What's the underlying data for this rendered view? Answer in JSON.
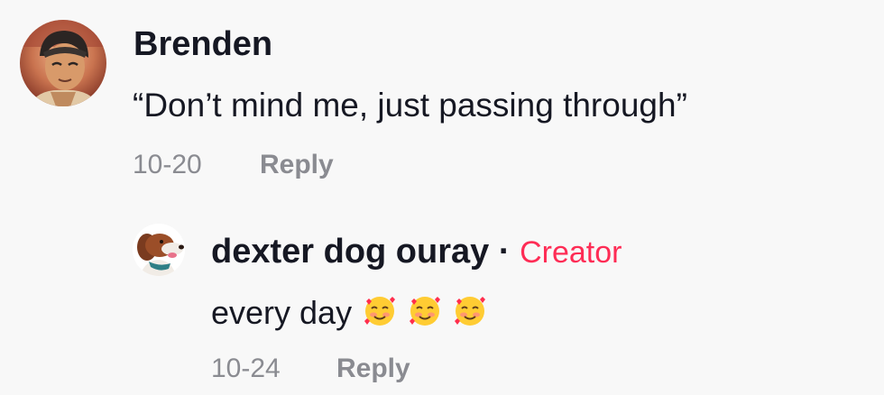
{
  "comment": {
    "username": "Brenden",
    "text": "“Don’t mind me, just passing through”",
    "date": "10-20",
    "reply_label": "Reply",
    "avatar_icon": "user-avatar-icon"
  },
  "reply": {
    "username": "dexter dog ouray",
    "separator": "·",
    "badge": "Creator",
    "text": "every day",
    "emoji_name": "smiling-face-with-hearts-icon",
    "emoji_count": 3,
    "date": "10-24",
    "reply_label": "Reply",
    "avatar_icon": "dog-avatar-icon"
  },
  "colors": {
    "background": "#f8f8f8",
    "text": "#161823",
    "muted": "#8a8b91",
    "creator_accent": "#fe2c55"
  }
}
